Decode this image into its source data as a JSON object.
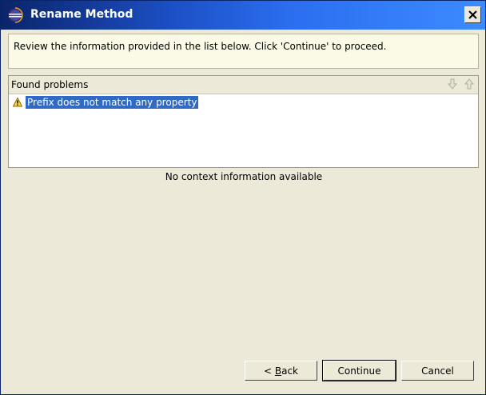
{
  "window": {
    "title": "Rename Method"
  },
  "message": {
    "text": "Review the information provided in the list below. Click 'Continue' to proceed."
  },
  "problems": {
    "header": "Found problems",
    "items": [
      {
        "text": "Prefix does not match any property",
        "severity": "warning",
        "selected": true
      }
    ]
  },
  "context": {
    "text": "No context information available"
  },
  "buttons": {
    "back_prefix": "< ",
    "back_mnemonic": "B",
    "back_suffix": "ack",
    "continue": "Continue",
    "cancel": "Cancel"
  },
  "colors": {
    "selection": "#316ac5",
    "dialog_bg": "#ece9d8",
    "banner_bg": "#fafae6"
  }
}
